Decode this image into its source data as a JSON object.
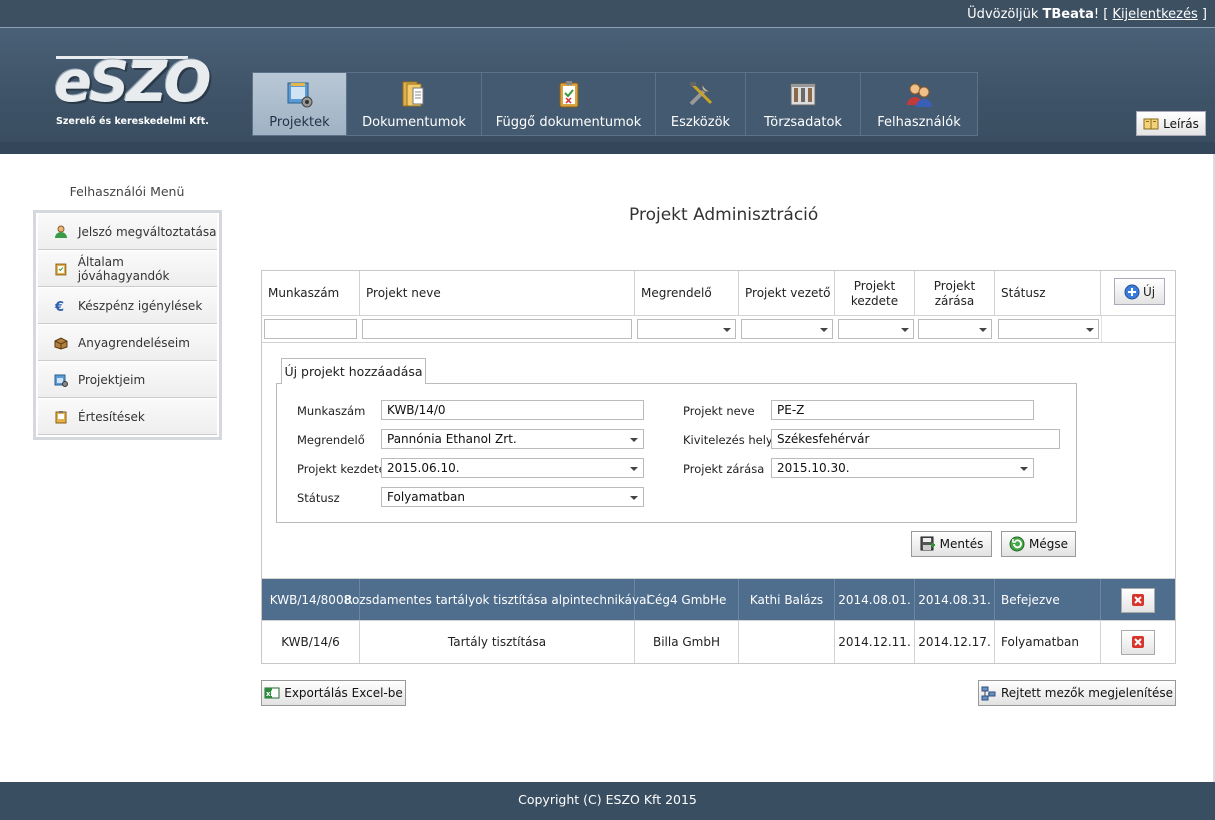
{
  "topbar": {
    "greeting_prefix": "Üdvözöljük ",
    "username": "TBeata",
    "greeting_suffix": "! [ ",
    "logout": "Kijelentkezés",
    "close_bracket": " ]"
  },
  "logo": {
    "brand": "eSZO",
    "subtitle": "Szerelő és kereskedelmi Kft."
  },
  "nav": [
    {
      "label": "Projektek",
      "icon": "projects-icon",
      "active": true
    },
    {
      "label": "Dokumentumok",
      "icon": "documents-icon"
    },
    {
      "label": "Függő dokumentumok",
      "icon": "pending-documents-icon"
    },
    {
      "label": "Eszközök",
      "icon": "tools-icon"
    },
    {
      "label": "Törzsadatok",
      "icon": "master-data-icon"
    },
    {
      "label": "Felhasználók",
      "icon": "users-icon"
    }
  ],
  "leiras_label": "Leírás",
  "side": {
    "title": "Felhasználói Menü",
    "items": [
      {
        "label": "Jelszó megváltoztatása",
        "icon": "user-key-icon"
      },
      {
        "label": "Általam jóváhagyandók",
        "icon": "approval-icon"
      },
      {
        "label": "Készpénz igénylések",
        "icon": "euro-icon"
      },
      {
        "label": "Anyagrendeléseim",
        "icon": "box-icon"
      },
      {
        "label": "Projektjeim",
        "icon": "my-projects-icon"
      },
      {
        "label": "Értesítések",
        "icon": "notification-icon"
      }
    ]
  },
  "page_title": "Projekt Adminisztráció",
  "grid": {
    "headers": {
      "munkaszam": "Munkaszám",
      "projekt_neve": "Projekt neve",
      "megrendelo": "Megrendelő",
      "projekt_vezeto": "Projekt vezető",
      "kezdete_1": "Projekt",
      "kezdete_2": "kezdete",
      "zarasa_1": "Projekt",
      "zarasa_2": "zárása",
      "statusz": "Státusz"
    },
    "new_label": "Új",
    "editor": {
      "tab_label": "Új projekt hozzáadása",
      "labels": {
        "munkaszam": "Munkaszám",
        "megrendelo": "Megrendelő",
        "kezdete": "Projekt kezdete",
        "statusz": "Státusz",
        "projekt_neve": "Projekt neve",
        "kivitelezes": "Kivitelezés helye",
        "zarasa": "Projekt zárása"
      },
      "values": {
        "munkaszam": "KWB/14/0",
        "megrendelo": "Pannónia Ethanol Zrt.",
        "kezdete": "2015.06.10.",
        "statusz": "Folyamatban",
        "projekt_neve": "PE-Z",
        "kivitelezes": "Székesfehérvár",
        "zarasa": "2015.10.30."
      },
      "save_label": "Mentés",
      "cancel_label": "Mégse"
    },
    "rows": [
      {
        "munkaszam": "KWB/14/8008",
        "neve": "Rozsdamentes tartályok tisztítása alpintechnikával",
        "megrendelo": "Cég4 GmbHe",
        "vezeto": "Kathi Balázs",
        "kezdete": "2014.08.01.",
        "zarasa": "2014.08.31.",
        "statusz": "Befejezve",
        "selected": true
      },
      {
        "munkaszam": "KWB/14/6",
        "neve": "Tartály tisztítása",
        "megrendelo": "Billa GmbH",
        "vezeto": "",
        "kezdete": "2014.12.11.",
        "zarasa": "2014.12.17.",
        "statusz": "Folyamatban",
        "selected": false
      }
    ]
  },
  "export_label": "Exportálás Excel-be",
  "hidden_fields_label": "Rejtett mezők megjelenítése",
  "footer": "Copyright (C) ESZO Kft 2015",
  "colors": {
    "header": "#3e5367",
    "selected_row": "#4f6d8d",
    "active_tab": "#b9c8d6",
    "delete": "#d9342b"
  }
}
